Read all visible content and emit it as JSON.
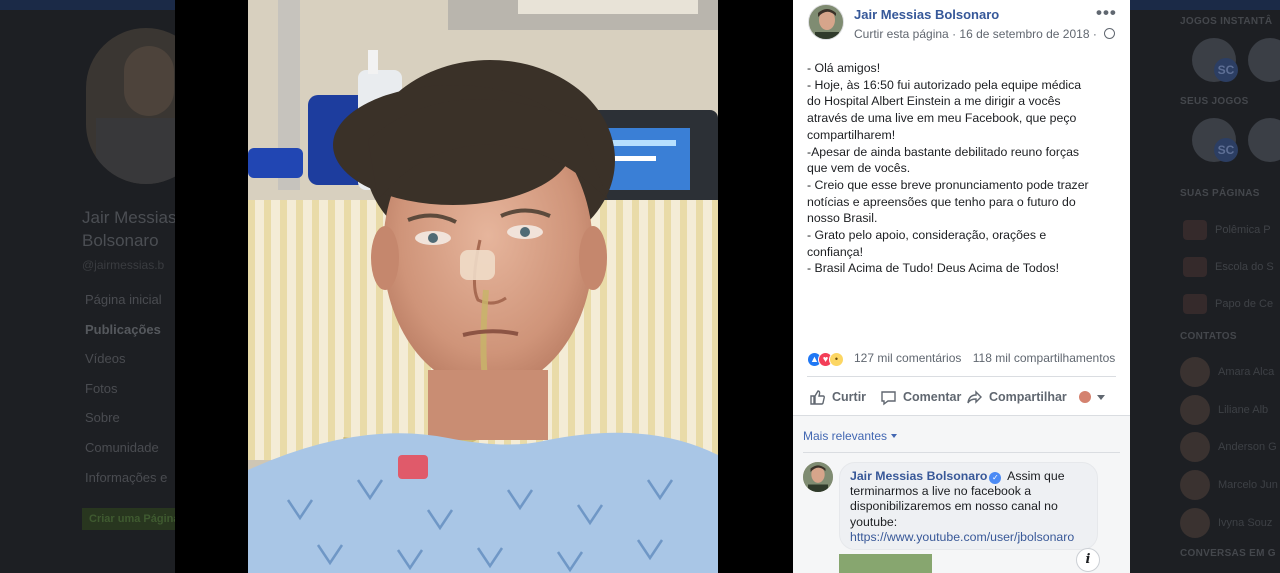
{
  "background": {
    "profile_name": "Jair Messias Bolsonaro",
    "profile_handle": "@jairmessias.b",
    "nav": [
      "Página inicial",
      "Publicações",
      "Vídeos",
      "Fotos",
      "Sobre",
      "Comunidade",
      "Informações e"
    ],
    "create_page": "Criar uma Página",
    "right": {
      "games_instant": "JOGOS INSTANTÂ",
      "your_games": "SEUS JOGOS",
      "your_pages": "SUAS PÁGINAS",
      "pages": [
        "Polêmica P",
        "Escola do S",
        "Papo de Ce"
      ],
      "contacts_head": "CONTATOS",
      "contacts": [
        "Amara Alca",
        "Liliane Alb",
        "Anderson G",
        "Marcelo Jun",
        "Ivyna Souz"
      ],
      "conversations": "CONVERSAS EM G",
      "game_badge": "SC"
    }
  },
  "post": {
    "page_name": "Jair Messias Bolsonaro",
    "like_page": "Curtir esta página",
    "dot": "·",
    "date": "16 de setembro de 2018",
    "dot2": "·",
    "options": "•••",
    "text_lines": [
      "- Olá amigos!",
      "- Hoje, às 16:50 fui autorizado pela equipe médica",
      "do Hospital Albert Einstein a me dirigir a vocês",
      "através de uma live em meu Facebook, que peço",
      "compartilharem!",
      "-Apesar de ainda bastante debilitado reuno forças",
      "que vem de vocês.",
      "- Creio que esse breve pronunciamento pode trazer",
      "notícias e apreensões que tenho para o futuro do",
      "nosso Brasil.",
      "- Grato pelo apoio, consideração, orações e",
      "confiança!",
      "- Brasil Acima de Tudo! Deus Acima de Todos!"
    ],
    "comments_count": "127 mil comentários",
    "shares_count": "118 mil compartilhamentos",
    "actions": {
      "like": "Curtir",
      "comment": "Comentar",
      "share": "Compartilhar"
    }
  },
  "comments": {
    "sort": "Mais relevantes",
    "first": {
      "author": "Jair Messias Bolsonaro",
      "text": "Assim que terminarmos a live no facebook a disponibilizaremos em nosso canal no youtube:",
      "link": "https://www.youtube.com/user/jbolsonaro",
      "info": "i"
    }
  },
  "colors": {
    "link": "#365899",
    "secondary_text": "#616770",
    "like_blue": "#2078f4",
    "love_red": "#f33e58"
  }
}
